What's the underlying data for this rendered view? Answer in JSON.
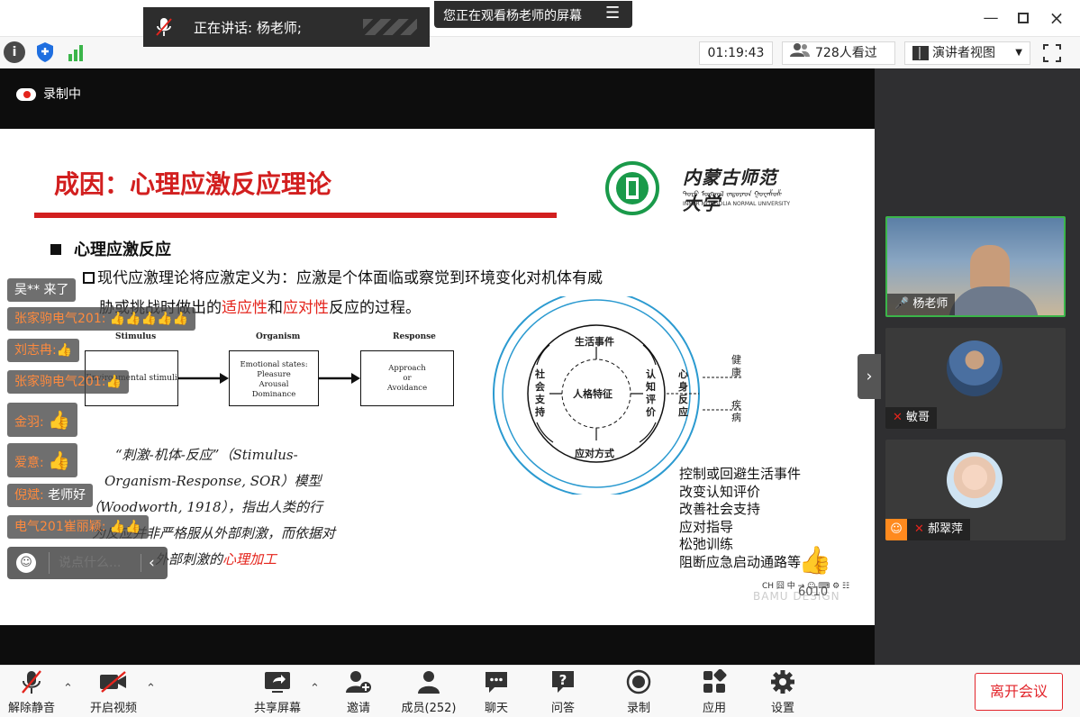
{
  "speaking": {
    "label": "正在讲话: 杨老师;"
  },
  "watching": {
    "label": "您正在观看杨老师的屏幕"
  },
  "toolbar": {
    "timer": "01:19:43",
    "viewers": "728人看过",
    "view_mode": "演讲者视图"
  },
  "recording": {
    "label": "录制中"
  },
  "slide": {
    "title": "成因：心理应激反应理论",
    "univ_cn": "内蒙古师范大学",
    "univ_mn": "ᠲᠤᠷᠣ ᠮᠣᠩᠭᠤᠯ ᠵᠠᠳᠤᠷᠠᠳ ᠭᠤᠸᠠᠱᠤᠱᠠᠨ",
    "univ_en": "INNER MONGOLIA NORMAL UNIVERSITY",
    "heading": "心理应激反应",
    "def_line1": "现代应激理论将应激定义为：应激是个体面临或察觉到环境变化对机体有威",
    "def_line2_a": "胁或挑战时做出的",
    "def_line2_b": "适应性",
    "def_line2_c": "和",
    "def_line2_d": "应对性",
    "def_line2_e": "反应的过程。",
    "box1_head": "Stimulus",
    "box1_text": "Environmental stimuli",
    "box2_head": "Organism",
    "box2_text": [
      "Emotional states:",
      "Pleasure",
      "Arousal",
      "Dominance"
    ],
    "box3_head": "Response",
    "box3_text": [
      "Approach",
      "or",
      "Avoidance"
    ],
    "hand1": "“刺激-机体-反应”（Stimulus-",
    "hand2": "Organism-Response, SOR）模型",
    "hand3": "（Woodworth, 1918），指出人类的行",
    "hand4": "为反应并非严格服从外部刺激，而依据对",
    "hand5_a": "外部刺激的",
    "hand5_b": "心理加工",
    "circle": {
      "top": "生活事件",
      "left": "社会支持",
      "center": "人格特征",
      "right": "认知评价",
      "bottom": "应对方式",
      "far_right": "心身反应",
      "health": "健康",
      "disease": "疾病"
    },
    "strategies": [
      "控制或回避生活事件",
      "改变认知评价",
      "改善社会支持",
      "应对指导",
      "松弛训练",
      "阻断应急启动通路等"
    ],
    "watermark": "BAMU DESIGN",
    "ime_bar": "CH 囧 中 → ☺ ⌨ ⚙ ☷",
    "counter": "6010"
  },
  "chat_messages": [
    {
      "name": "吴** 来了",
      "text": ""
    },
    {
      "name": "张家驹电气201:",
      "text": "👍👍👍👍👍"
    },
    {
      "name": "刘志冉:",
      "text": "👍"
    },
    {
      "name": "张家驹电气201:",
      "text": "👍"
    },
    {
      "name": "金羽:",
      "text": "👍"
    },
    {
      "name": "爱意:",
      "text": "👍"
    },
    {
      "name": "倪斌:",
      "text": "老师好"
    },
    {
      "name": "电气201崔丽颖:",
      "text": "👍👍"
    }
  ],
  "chat_input": {
    "placeholder": "说点什么..."
  },
  "participants": [
    {
      "name": "杨老师"
    },
    {
      "name": "敏哥"
    },
    {
      "name": "郝翠萍"
    }
  ],
  "bottom": {
    "unmute": "解除静音",
    "video": "开启视频",
    "share": "共享屏幕",
    "invite": "邀请",
    "members": "成员(252)",
    "chat": "聊天",
    "qa": "问答",
    "record": "录制",
    "apps": "应用",
    "settings": "设置",
    "leave": "离开会议"
  },
  "colors": {
    "accent_red": "#d21f1f",
    "leave_red": "#e2252b",
    "active_green": "#3bb54a",
    "panel_bg": "#2f2f31"
  }
}
